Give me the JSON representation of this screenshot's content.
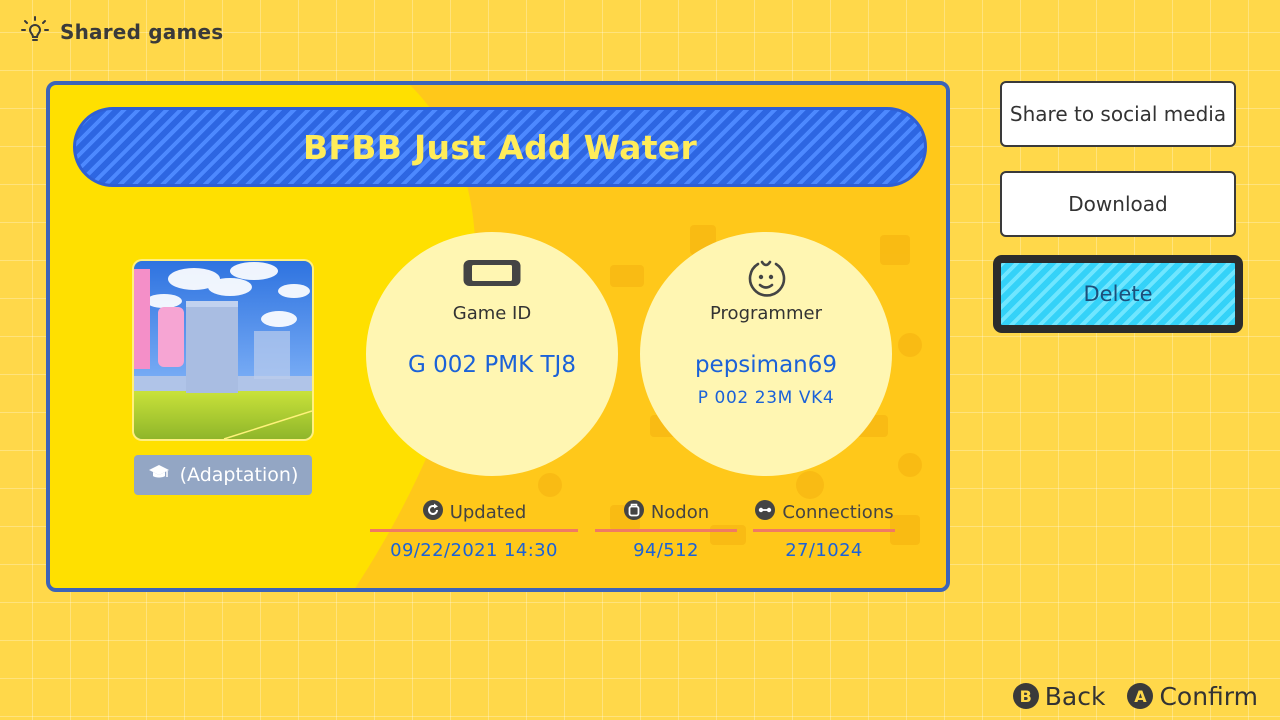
{
  "header": {
    "title": "Shared games",
    "icon": "lightbulb-icon"
  },
  "game": {
    "title": "BFBB Just Add Water",
    "tag": "(Adaptation)",
    "game_id_label": "Game ID",
    "game_id": "G 002 PMK TJ8",
    "programmer_label": "Programmer",
    "programmer_name": "pepsiman69",
    "programmer_id": "P 002 23M VK4"
  },
  "stats": {
    "updated_label": "Updated",
    "updated_value": "09/22/2021 14:30",
    "nodon_label": "Nodon",
    "nodon_value": "94/512",
    "connections_label": "Connections",
    "connections_value": "27/1024"
  },
  "actions": {
    "share_label": "Share to social media",
    "download_label": "Download",
    "delete_label": "Delete"
  },
  "footer": {
    "back_key": "B",
    "back_label": "Back",
    "confirm_key": "A",
    "confirm_label": "Confirm"
  },
  "colors": {
    "background": "#ffd84a",
    "card": "#ffe000",
    "card_border": "#3c64b8",
    "banner": "#2f6ce8",
    "title_text": "#ffec5a",
    "value_text": "#1b62d8",
    "delete_button": "#39d8ff",
    "stat_underline": "#f07a63"
  }
}
